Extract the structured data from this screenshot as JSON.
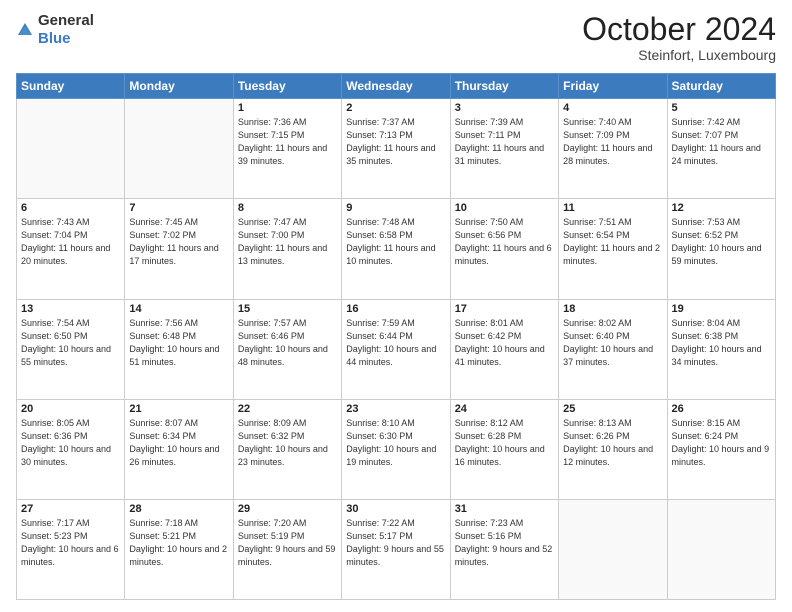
{
  "header": {
    "logo_general": "General",
    "logo_blue": "Blue",
    "month_title": "October 2024",
    "location": "Steinfort, Luxembourg"
  },
  "weekdays": [
    "Sunday",
    "Monday",
    "Tuesday",
    "Wednesday",
    "Thursday",
    "Friday",
    "Saturday"
  ],
  "weeks": [
    [
      {
        "day": "",
        "sunrise": "",
        "sunset": "",
        "daylight": ""
      },
      {
        "day": "",
        "sunrise": "",
        "sunset": "",
        "daylight": ""
      },
      {
        "day": "1",
        "sunrise": "Sunrise: 7:36 AM",
        "sunset": "Sunset: 7:15 PM",
        "daylight": "Daylight: 11 hours and 39 minutes."
      },
      {
        "day": "2",
        "sunrise": "Sunrise: 7:37 AM",
        "sunset": "Sunset: 7:13 PM",
        "daylight": "Daylight: 11 hours and 35 minutes."
      },
      {
        "day": "3",
        "sunrise": "Sunrise: 7:39 AM",
        "sunset": "Sunset: 7:11 PM",
        "daylight": "Daylight: 11 hours and 31 minutes."
      },
      {
        "day": "4",
        "sunrise": "Sunrise: 7:40 AM",
        "sunset": "Sunset: 7:09 PM",
        "daylight": "Daylight: 11 hours and 28 minutes."
      },
      {
        "day": "5",
        "sunrise": "Sunrise: 7:42 AM",
        "sunset": "Sunset: 7:07 PM",
        "daylight": "Daylight: 11 hours and 24 minutes."
      }
    ],
    [
      {
        "day": "6",
        "sunrise": "Sunrise: 7:43 AM",
        "sunset": "Sunset: 7:04 PM",
        "daylight": "Daylight: 11 hours and 20 minutes."
      },
      {
        "day": "7",
        "sunrise": "Sunrise: 7:45 AM",
        "sunset": "Sunset: 7:02 PM",
        "daylight": "Daylight: 11 hours and 17 minutes."
      },
      {
        "day": "8",
        "sunrise": "Sunrise: 7:47 AM",
        "sunset": "Sunset: 7:00 PM",
        "daylight": "Daylight: 11 hours and 13 minutes."
      },
      {
        "day": "9",
        "sunrise": "Sunrise: 7:48 AM",
        "sunset": "Sunset: 6:58 PM",
        "daylight": "Daylight: 11 hours and 10 minutes."
      },
      {
        "day": "10",
        "sunrise": "Sunrise: 7:50 AM",
        "sunset": "Sunset: 6:56 PM",
        "daylight": "Daylight: 11 hours and 6 minutes."
      },
      {
        "day": "11",
        "sunrise": "Sunrise: 7:51 AM",
        "sunset": "Sunset: 6:54 PM",
        "daylight": "Daylight: 11 hours and 2 minutes."
      },
      {
        "day": "12",
        "sunrise": "Sunrise: 7:53 AM",
        "sunset": "Sunset: 6:52 PM",
        "daylight": "Daylight: 10 hours and 59 minutes."
      }
    ],
    [
      {
        "day": "13",
        "sunrise": "Sunrise: 7:54 AM",
        "sunset": "Sunset: 6:50 PM",
        "daylight": "Daylight: 10 hours and 55 minutes."
      },
      {
        "day": "14",
        "sunrise": "Sunrise: 7:56 AM",
        "sunset": "Sunset: 6:48 PM",
        "daylight": "Daylight: 10 hours and 51 minutes."
      },
      {
        "day": "15",
        "sunrise": "Sunrise: 7:57 AM",
        "sunset": "Sunset: 6:46 PM",
        "daylight": "Daylight: 10 hours and 48 minutes."
      },
      {
        "day": "16",
        "sunrise": "Sunrise: 7:59 AM",
        "sunset": "Sunset: 6:44 PM",
        "daylight": "Daylight: 10 hours and 44 minutes."
      },
      {
        "day": "17",
        "sunrise": "Sunrise: 8:01 AM",
        "sunset": "Sunset: 6:42 PM",
        "daylight": "Daylight: 10 hours and 41 minutes."
      },
      {
        "day": "18",
        "sunrise": "Sunrise: 8:02 AM",
        "sunset": "Sunset: 6:40 PM",
        "daylight": "Daylight: 10 hours and 37 minutes."
      },
      {
        "day": "19",
        "sunrise": "Sunrise: 8:04 AM",
        "sunset": "Sunset: 6:38 PM",
        "daylight": "Daylight: 10 hours and 34 minutes."
      }
    ],
    [
      {
        "day": "20",
        "sunrise": "Sunrise: 8:05 AM",
        "sunset": "Sunset: 6:36 PM",
        "daylight": "Daylight: 10 hours and 30 minutes."
      },
      {
        "day": "21",
        "sunrise": "Sunrise: 8:07 AM",
        "sunset": "Sunset: 6:34 PM",
        "daylight": "Daylight: 10 hours and 26 minutes."
      },
      {
        "day": "22",
        "sunrise": "Sunrise: 8:09 AM",
        "sunset": "Sunset: 6:32 PM",
        "daylight": "Daylight: 10 hours and 23 minutes."
      },
      {
        "day": "23",
        "sunrise": "Sunrise: 8:10 AM",
        "sunset": "Sunset: 6:30 PM",
        "daylight": "Daylight: 10 hours and 19 minutes."
      },
      {
        "day": "24",
        "sunrise": "Sunrise: 8:12 AM",
        "sunset": "Sunset: 6:28 PM",
        "daylight": "Daylight: 10 hours and 16 minutes."
      },
      {
        "day": "25",
        "sunrise": "Sunrise: 8:13 AM",
        "sunset": "Sunset: 6:26 PM",
        "daylight": "Daylight: 10 hours and 12 minutes."
      },
      {
        "day": "26",
        "sunrise": "Sunrise: 8:15 AM",
        "sunset": "Sunset: 6:24 PM",
        "daylight": "Daylight: 10 hours and 9 minutes."
      }
    ],
    [
      {
        "day": "27",
        "sunrise": "Sunrise: 7:17 AM",
        "sunset": "Sunset: 5:23 PM",
        "daylight": "Daylight: 10 hours and 6 minutes."
      },
      {
        "day": "28",
        "sunrise": "Sunrise: 7:18 AM",
        "sunset": "Sunset: 5:21 PM",
        "daylight": "Daylight: 10 hours and 2 minutes."
      },
      {
        "day": "29",
        "sunrise": "Sunrise: 7:20 AM",
        "sunset": "Sunset: 5:19 PM",
        "daylight": "Daylight: 9 hours and 59 minutes."
      },
      {
        "day": "30",
        "sunrise": "Sunrise: 7:22 AM",
        "sunset": "Sunset: 5:17 PM",
        "daylight": "Daylight: 9 hours and 55 minutes."
      },
      {
        "day": "31",
        "sunrise": "Sunrise: 7:23 AM",
        "sunset": "Sunset: 5:16 PM",
        "daylight": "Daylight: 9 hours and 52 minutes."
      },
      {
        "day": "",
        "sunrise": "",
        "sunset": "",
        "daylight": ""
      },
      {
        "day": "",
        "sunrise": "",
        "sunset": "",
        "daylight": ""
      }
    ]
  ]
}
